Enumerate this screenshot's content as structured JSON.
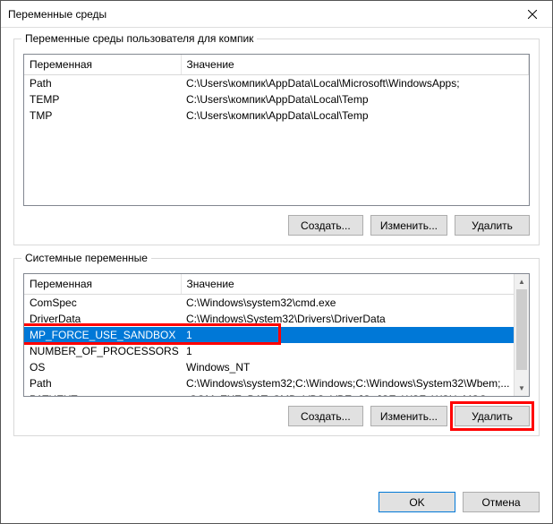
{
  "window": {
    "title": "Переменные среды"
  },
  "userSection": {
    "label": "Переменные среды пользователя для компик",
    "columns": {
      "var": "Переменная",
      "val": "Значение"
    },
    "rows": [
      {
        "var": "Path",
        "val": "C:\\Users\\компик\\AppData\\Local\\Microsoft\\WindowsApps;"
      },
      {
        "var": "TEMP",
        "val": "C:\\Users\\компик\\AppData\\Local\\Temp"
      },
      {
        "var": "TMP",
        "val": "C:\\Users\\компик\\AppData\\Local\\Temp"
      }
    ],
    "buttons": {
      "new": "Создать...",
      "edit": "Изменить...",
      "delete": "Удалить"
    }
  },
  "systemSection": {
    "label": "Системные переменные",
    "columns": {
      "var": "Переменная",
      "val": "Значение"
    },
    "rows": [
      {
        "var": "ComSpec",
        "val": "C:\\Windows\\system32\\cmd.exe"
      },
      {
        "var": "DriverData",
        "val": "C:\\Windows\\System32\\Drivers\\DriverData"
      },
      {
        "var": "MP_FORCE_USE_SANDBOX",
        "val": "1",
        "selected": true
      },
      {
        "var": "NUMBER_OF_PROCESSORS",
        "val": "1"
      },
      {
        "var": "OS",
        "val": "Windows_NT"
      },
      {
        "var": "Path",
        "val": "C:\\Windows\\system32;C:\\Windows;C:\\Windows\\System32\\Wbem;..."
      },
      {
        "var": "PATHEXT",
        "val": ".COM;.EXE;.BAT;.CMD;.VBS;.VBE;.JS;.JSE;.WSF;.WSH;.MSC"
      }
    ],
    "buttons": {
      "new": "Создать...",
      "edit": "Изменить...",
      "delete": "Удалить"
    }
  },
  "dialog": {
    "ok": "OK",
    "cancel": "Отмена"
  }
}
